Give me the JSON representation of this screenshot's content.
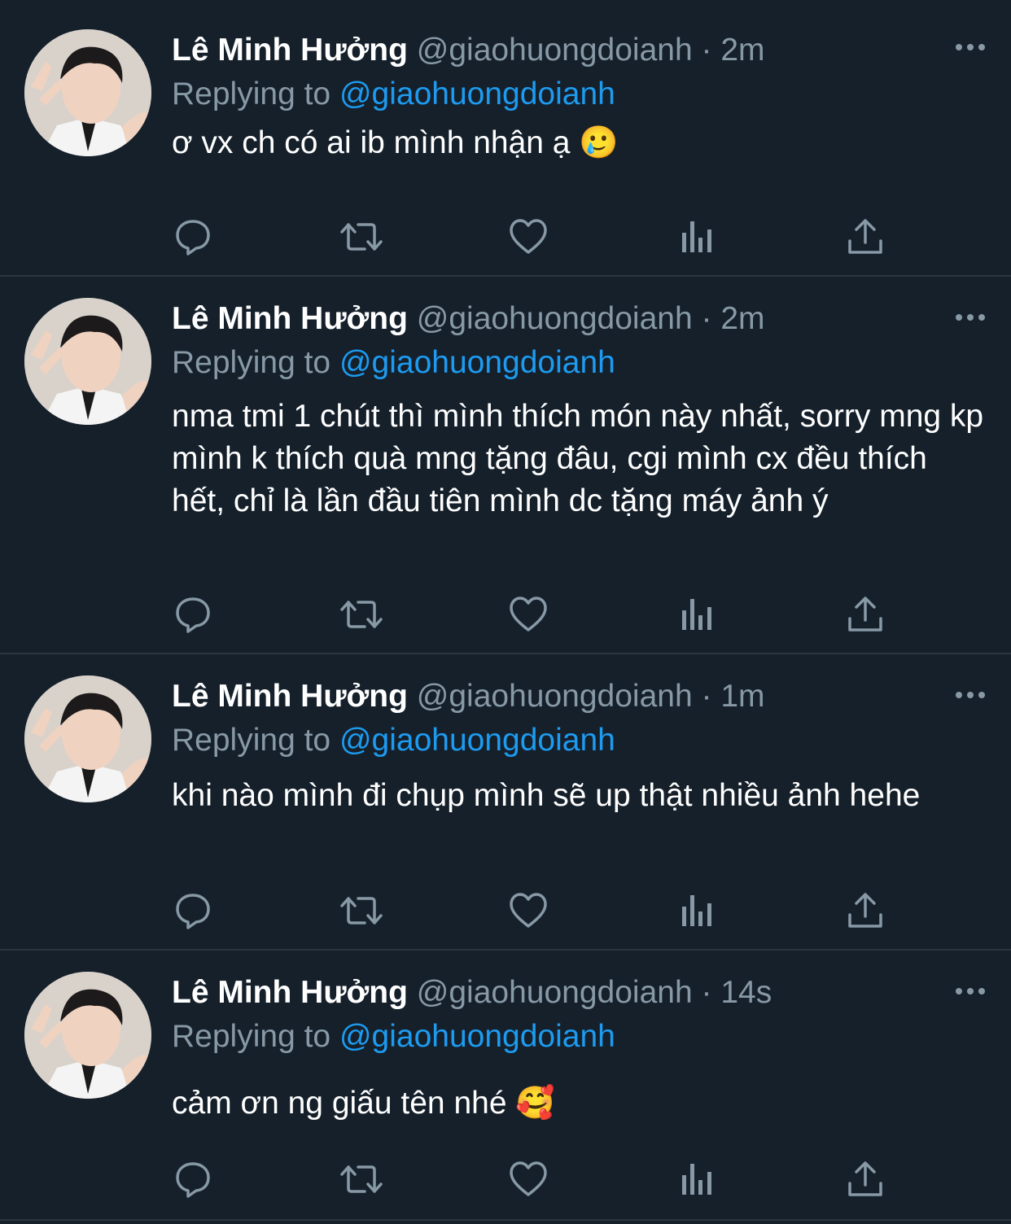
{
  "tweets": [
    {
      "name": "Lê Minh Hưởng",
      "handle": "@giaohuongdoianh",
      "dot": "·",
      "time": "2m",
      "replying_prefix": "Replying to",
      "replying_to": "@giaohuongdoianh",
      "text": "ơ vx ch có ai ib mình nhận ạ",
      "emoji": "🥲"
    },
    {
      "name": "Lê Minh Hưởng",
      "handle": "@giaohuongdoianh",
      "dot": "·",
      "time": "2m",
      "replying_prefix": "Replying to",
      "replying_to": "@giaohuongdoianh",
      "text": "nma tmi 1 chút thì mình thích món này nhất, sorry mng kp mình k thích quà mng tặng đâu, cgi mình cx đều thích hết, chỉ là lần đầu tiên mình dc tặng máy ảnh ý",
      "emoji": ""
    },
    {
      "name": "Lê Minh Hưởng",
      "handle": "@giaohuongdoianh",
      "dot": "·",
      "time": "1m",
      "replying_prefix": "Replying to",
      "replying_to": "@giaohuongdoianh",
      "text": "khi nào mình đi chụp mình sẽ up thật nhiều ảnh hehe",
      "emoji": ""
    },
    {
      "name": "Lê Minh Hưởng",
      "handle": "@giaohuongdoianh",
      "dot": "·",
      "time": "14s",
      "replying_prefix": "Replying to",
      "replying_to": "@giaohuongdoianh",
      "text": "cảm ơn ng giấu tên nhé",
      "emoji": "🥰"
    }
  ],
  "icons": {
    "more": "more-horizontal-icon",
    "reply": "reply-icon",
    "retweet": "retweet-icon",
    "like": "heart-icon",
    "analytics": "analytics-icon",
    "share": "share-icon"
  },
  "colors": {
    "background": "#15202b",
    "secondary_text": "#8899a6",
    "link": "#1d9bf0",
    "divider": "#2b3640"
  }
}
